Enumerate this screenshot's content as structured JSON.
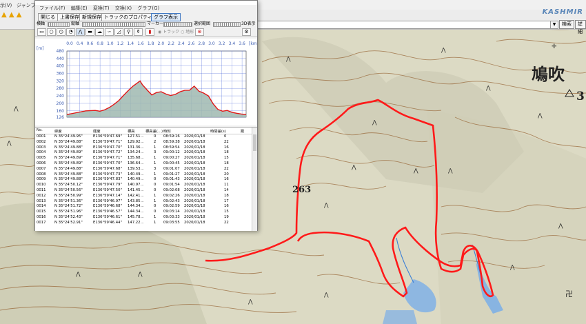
{
  "app": {
    "brand": "KASHMIR",
    "menu": [
      "示(V)",
      "ジャンプ(J)"
    ],
    "toolbar_right": [
      "検索",
      "詳細"
    ]
  },
  "map": {
    "place_labels": [
      "鳩吹",
      "263",
      "3"
    ],
    "colors": {
      "track": "#ff1a1a",
      "contour": "#8a5a32",
      "water": "#3a7fd6",
      "terrain": "#e2e0cc"
    }
  },
  "window": {
    "menu": [
      "ファイル(F)",
      "編集(E)",
      "変換(T)",
      "交換(X)",
      "グラフ(G)"
    ],
    "buttons": [
      "開じる",
      "上書保存",
      "新規保存",
      "トラックのプロパティ",
      "グラフ表示"
    ],
    "sliders": {
      "horizontal": "横軸",
      "vertical": "縦軸",
      "marker": "マーカー",
      "range": "選択範囲",
      "three_d": "3D表示"
    },
    "radio": [
      "トラック",
      "地形"
    ]
  },
  "chart_data": {
    "type": "area",
    "x_unit": "[km]",
    "y_unit": "[m]",
    "x_ticks": [
      "0.0",
      "0.4",
      "0.6",
      "0.8",
      "1.0",
      "1.2",
      "1.4",
      "1.6",
      "1.8",
      "2.0",
      "2.2",
      "2.4",
      "2.6",
      "2.8",
      "3.0",
      "3.2",
      "3.4",
      "3.6"
    ],
    "y_ticks": [
      480,
      440,
      400,
      360,
      320,
      280,
      240,
      200,
      160,
      126
    ],
    "xlim": [
      0,
      3.8
    ],
    "ylim": [
      126,
      480
    ],
    "series": [
      {
        "x": [
          0,
          0.2,
          0.4,
          0.6,
          0.7,
          0.8,
          0.9,
          1.0,
          1.1,
          1.2,
          1.3,
          1.4,
          1.5,
          1.55,
          1.6,
          1.7,
          1.8,
          1.9,
          2.0,
          2.1,
          2.2,
          2.3,
          2.4,
          2.5,
          2.6,
          2.7,
          2.8,
          2.9,
          3.0,
          3.1,
          3.2,
          3.3,
          3.4,
          3.5,
          3.6,
          3.7,
          3.8
        ],
        "y": [
          140,
          150,
          160,
          162,
          158,
          165,
          178,
          195,
          215,
          242,
          268,
          292,
          310,
          320,
          300,
          272,
          245,
          258,
          262,
          250,
          242,
          248,
          262,
          270,
          270,
          292,
          265,
          255,
          240,
          198,
          168,
          158,
          162,
          152,
          147,
          143,
          140
        ]
      }
    ]
  },
  "table": {
    "columns": [
      "No.",
      "緯度",
      "経度",
      "標高",
      "標高差(...)",
      "時刻",
      "",
      "時間差(s)",
      "距"
    ],
    "rows": [
      [
        "0001",
        "N 35°24'49.95\"",
        "E136°59'47.69\"",
        "127.51...",
        "0",
        "08:59:16",
        "2020/01/18",
        "0"
      ],
      [
        "0002",
        "N 35°24'49.88\"",
        "E136°59'47.71\"",
        "129.92...",
        "2",
        "08:59:38",
        "2020/01/18",
        "22"
      ],
      [
        "0003",
        "N 35°24'49.88\"",
        "E136°59'47.70\"",
        "131.36...",
        "1",
        "08:59:54",
        "2020/01/18",
        "16"
      ],
      [
        "0004",
        "N 35°24'49.89\"",
        "E136°59'47.72\"",
        "134.24...",
        "3",
        "09:00:12",
        "2020/01/18",
        "18"
      ],
      [
        "0005",
        "N 35°24'49.89\"",
        "E136°59'47.71\"",
        "135.68...",
        "1",
        "09:00:27",
        "2020/01/18",
        "15"
      ],
      [
        "0006",
        "N 35°24'49.89\"",
        "E136°59'47.70\"",
        "136.64...",
        "1",
        "09:00:45",
        "2020/01/18",
        "18"
      ],
      [
        "0007",
        "N 35°24'49.88\"",
        "E136°59'47.68\"",
        "139.53...",
        "3",
        "09:01:07",
        "2020/01/18",
        "22"
      ],
      [
        "0008",
        "N 35°24'49.88\"",
        "E136°59'47.73\"",
        "140.49...",
        "1",
        "09:01:27",
        "2020/01/18",
        "20"
      ],
      [
        "0009",
        "N 35°24'49.88\"",
        "E136°59'47.83\"",
        "140.49...",
        "0",
        "09:01:43",
        "2020/01/18",
        "16"
      ],
      [
        "0010",
        "N 35°24'50.12\"",
        "E136°59'47.79\"",
        "140.97...",
        "0",
        "09:01:54",
        "2020/01/18",
        "11"
      ],
      [
        "0011",
        "N 35°24'50.56\"",
        "E136°59'47.50\"",
        "141.45...",
        "0",
        "09:02:08",
        "2020/01/18",
        "14"
      ],
      [
        "0012",
        "N 35°24'50.99\"",
        "E136°59'47.14\"",
        "142.41...",
        "1",
        "09:02:26",
        "2020/01/18",
        "18"
      ],
      [
        "0013",
        "N 35°24'51.36\"",
        "E136°59'46.97\"",
        "143.85...",
        "1",
        "09:02:43",
        "2020/01/18",
        "17"
      ],
      [
        "0014",
        "N 35°24'51.72\"",
        "E136°59'46.68\"",
        "144.34...",
        "0",
        "09:02:59",
        "2020/01/18",
        "16"
      ],
      [
        "0015",
        "N 35°24'51.96\"",
        "E136°59'46.57\"",
        "144.34...",
        "0",
        "09:03:14",
        "2020/01/18",
        "15"
      ],
      [
        "0016",
        "N 35°24'52.43\"",
        "E136°59'46.61\"",
        "145.78...",
        "1",
        "09:03:33",
        "2020/01/18",
        "19"
      ],
      [
        "0017",
        "N 35°24'52.91\"",
        "E136°59'46.44\"",
        "147.22...",
        "1",
        "09:03:55",
        "2020/01/18",
        "22"
      ]
    ]
  }
}
